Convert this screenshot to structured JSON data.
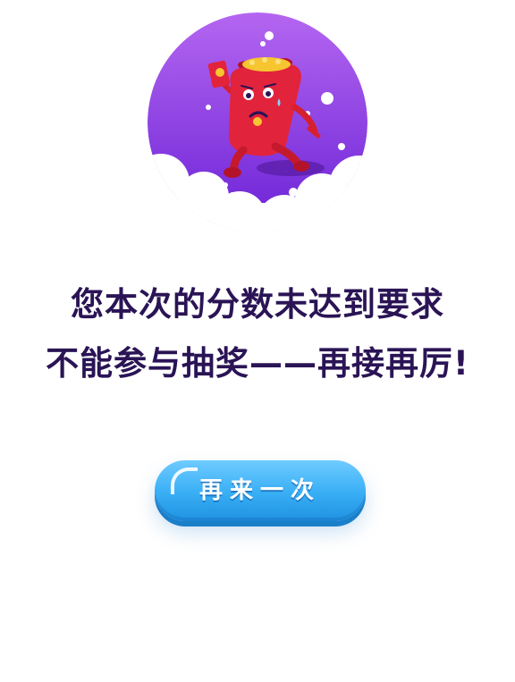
{
  "message": {
    "line1": "您本次的分数未达到要求",
    "line2": "不能参与抽奖——再接再厉!"
  },
  "retry_button": {
    "label": "再来一次"
  },
  "illustration": {
    "subject": "sad-red-envelope-character",
    "colors": {
      "circle_top": "#b466f0",
      "circle_bottom": "#6a22d6",
      "envelope": "#e2233c",
      "clouds": "#ffffff"
    }
  },
  "colors": {
    "text": "#2a1455",
    "button": "#38aef5"
  }
}
